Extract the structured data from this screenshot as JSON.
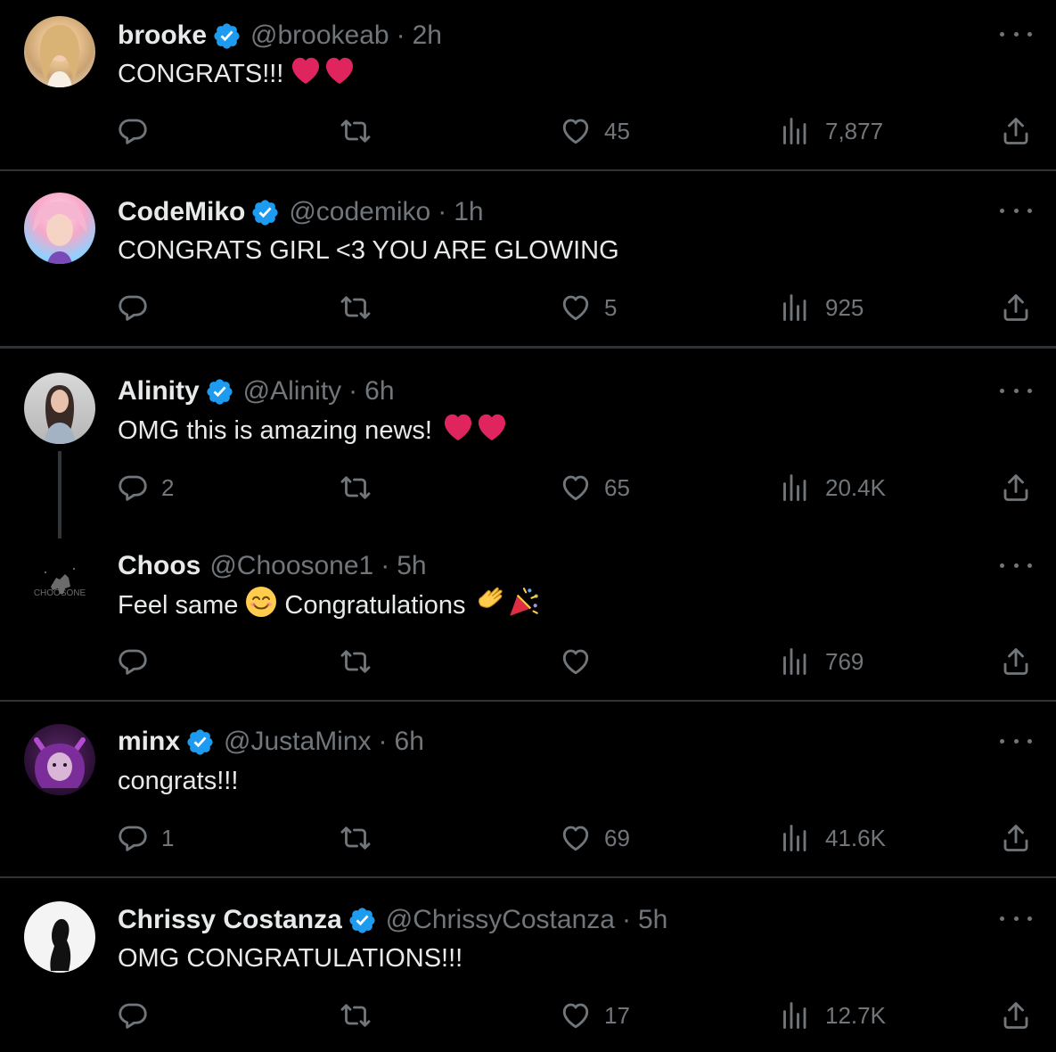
{
  "tweets": [
    {
      "name": "brooke",
      "handle": "@brookeab",
      "dot": "·",
      "time": "2h",
      "text": "CONGRATS!!!",
      "emoji": "hearts",
      "reply": "",
      "retweet": "",
      "like": "45",
      "views": "7,877"
    },
    {
      "name": "CodeMiko",
      "handle": "@codemiko",
      "dot": "·",
      "time": "1h",
      "text": "CONGRATS GIRL <3 YOU ARE GLOWING",
      "emoji": "",
      "reply": "",
      "retweet": "",
      "like": "5",
      "views": "925"
    },
    {
      "name": "Alinity",
      "handle": "@Alinity",
      "dot": "·",
      "time": "6h",
      "text": "OMG this is amazing news!",
      "emoji": "hearts",
      "reply": "2",
      "retweet": "",
      "like": "65",
      "views": "20.4K"
    },
    {
      "name": "Choos",
      "handle": "@Choosone1",
      "dot": "·",
      "time": "5h",
      "text": "Feel same",
      "text2": "Congratulations",
      "emoji": "smile-clap-party",
      "reply": "",
      "retweet": "",
      "like": "",
      "views": "769",
      "avatar_label": "CHOOSONE"
    },
    {
      "name": "minx",
      "handle": "@JustaMinx",
      "dot": "·",
      "time": "6h",
      "text": "congrats!!!",
      "emoji": "",
      "reply": "1",
      "retweet": "",
      "like": "69",
      "views": "41.6K"
    },
    {
      "name": "Chrissy Costanza",
      "handle": "@ChrissyCostanza",
      "dot": "·",
      "time": "5h",
      "text": "OMG CONGRATULATIONS!!!",
      "emoji": "",
      "reply": "",
      "retweet": "",
      "like": "17",
      "views": "12.7K"
    }
  ],
  "colors": {
    "background": "#000000",
    "text": "#e7e9ea",
    "muted": "#71767b",
    "verified": "#1d9bf0",
    "heart": "#e0245e",
    "separator": "#2f3336"
  }
}
